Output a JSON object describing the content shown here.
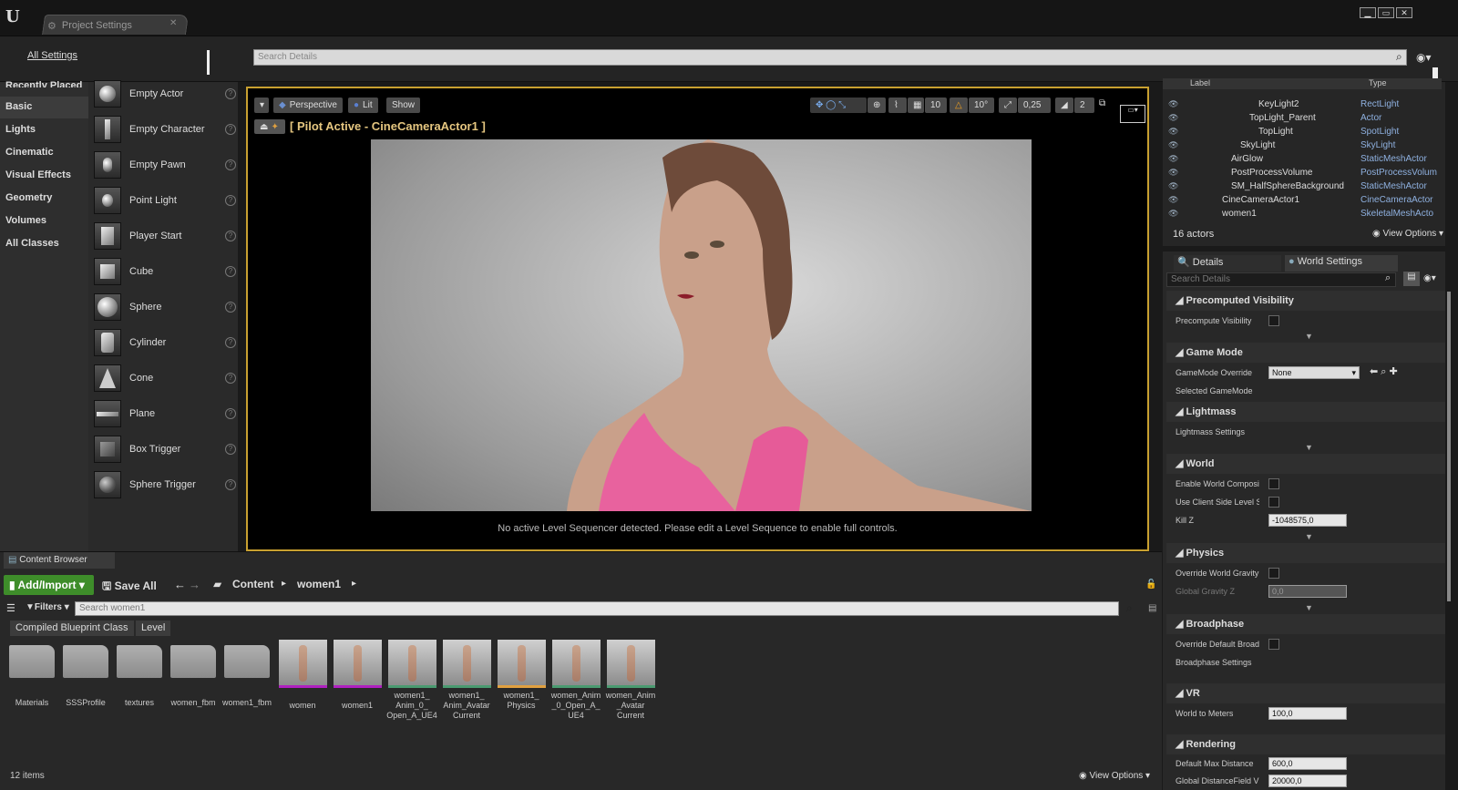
{
  "window": {
    "tab_title": "Project Settings",
    "logo": "U"
  },
  "settings": {
    "all_settings": "All Settings",
    "search_placeholder": "Search Details"
  },
  "categories": {
    "recently_placed": "Recently Placed",
    "items": [
      "Basic",
      "Lights",
      "Cinematic",
      "Visual Effects",
      "Geometry",
      "Volumes",
      "All Classes"
    ],
    "selected": "Basic"
  },
  "place_items": [
    "Empty Actor",
    "Empty Character",
    "Empty Pawn",
    "Point Light",
    "Player Start",
    "Cube",
    "Sphere",
    "Cylinder",
    "Cone",
    "Plane",
    "Box Trigger",
    "Sphere Trigger"
  ],
  "viewport": {
    "perspective": "Perspective",
    "lit": "Lit",
    "show": "Show",
    "pilot": "[ Pilot Active - CineCameraActor1 ]",
    "grid": "10",
    "rot": "10°",
    "scale": "0,25",
    "speed": "2",
    "message": "No active Level Sequencer detected. Please edit a Level Sequence to enable full controls."
  },
  "outliner": {
    "label_header": "Label",
    "type_header": "Type",
    "rows": [
      {
        "label": "KeyLight2",
        "type": "RectLight"
      },
      {
        "label": "TopLight_Parent",
        "type": "Actor"
      },
      {
        "label": "TopLight",
        "type": "SpotLight"
      },
      {
        "label": "SkyLight",
        "type": "SkyLight"
      },
      {
        "label": "AirGlow",
        "type": "StaticMeshActor"
      },
      {
        "label": "PostProcessVolume",
        "type": "PostProcessVolum"
      },
      {
        "label": "SM_HalfSphereBackground",
        "type": "StaticMeshActor"
      },
      {
        "label": "CineCameraActor1",
        "type": "CineCameraActor"
      },
      {
        "label": "women1",
        "type": "SkeletalMeshActo"
      }
    ],
    "actors": "16 actors",
    "view_options": "View Options"
  },
  "details": {
    "tab_details": "Details",
    "tab_world": "World Settings",
    "search_placeholder": "Search Details",
    "precomputed_visibility": "Precomputed Visibility",
    "precompute_visibility": "Precompute Visibility",
    "game_mode": "Game Mode",
    "gamemode_override": "GameMode Override",
    "gamemode_value": "None",
    "selected_gamemode": "Selected GameMode",
    "lightmass": "Lightmass",
    "lightmass_settings": "Lightmass Settings",
    "world": "World",
    "enable_world_composition": "Enable World Composi",
    "use_client_side": "Use Client Side Level S",
    "kill_z": "Kill Z",
    "kill_z_value": "-1048575,0",
    "physics": "Physics",
    "override_world_gravity": "Override World Gravity",
    "global_gravity_z": "Global Gravity Z",
    "global_gravity_value": "0,0",
    "broadphase": "Broadphase",
    "override_default_broad": "Override Default Broad",
    "broadphase_settings": "Broadphase Settings",
    "vr": "VR",
    "world_to_meters": "World to Meters",
    "world_to_meters_value": "100,0",
    "rendering": "Rendering",
    "default_max_distance": "Default Max Distance",
    "default_max_distance_value": "600,0",
    "global_distancefield": "Global DistanceField V",
    "global_distancefield_value": "20000,0"
  },
  "content_browser": {
    "tab": "Content Browser",
    "add_import": "Add/Import",
    "save_all": "Save All",
    "path_content": "Content",
    "path_folder": "women1",
    "filters": "Filters",
    "search_placeholder": "Search women1",
    "chip1": "Compiled Blueprint Class",
    "chip2": "Level",
    "assets": [
      {
        "name": "Materials",
        "kind": "folder"
      },
      {
        "name": "SSSProfile",
        "kind": "folder"
      },
      {
        "name": "textures",
        "kind": "folder"
      },
      {
        "name": "women_fbm",
        "kind": "folder"
      },
      {
        "name": "women1_fbm",
        "kind": "folder"
      },
      {
        "name": "women",
        "kind": "mesh"
      },
      {
        "name": "women1",
        "kind": "mesh"
      },
      {
        "name": "women1_ Anim_0_ Open_A_UE4",
        "kind": "anim"
      },
      {
        "name": "women1_ Anim_Avatar Current",
        "kind": "anim"
      },
      {
        "name": "women1_ Physics",
        "kind": "phys"
      },
      {
        "name": "women_Anim _0_Open_A_ UE4",
        "kind": "anim"
      },
      {
        "name": "women_Anim _Avatar Current",
        "kind": "anim"
      }
    ],
    "items": "12 items",
    "view_options": "View Options"
  }
}
